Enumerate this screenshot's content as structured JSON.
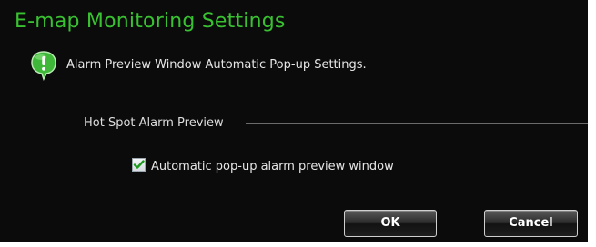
{
  "dialog": {
    "title": "E-map Monitoring Settings",
    "info_text": "Alarm Preview Window Automatic Pop-up Settings."
  },
  "section": {
    "label": "Hot Spot Alarm Preview"
  },
  "auto_popup": {
    "label": "Automatic pop-up alarm preview window",
    "checked": true
  },
  "buttons": {
    "ok_label": "OK",
    "cancel_label": "Cancel"
  },
  "colors": {
    "title": "#39c132",
    "background": "#0b0b0b",
    "checkmark": "#1f9b1f",
    "info_icon": "#3fb83a"
  },
  "icons": {
    "info": "info-icon",
    "check": "checkmark-icon"
  }
}
